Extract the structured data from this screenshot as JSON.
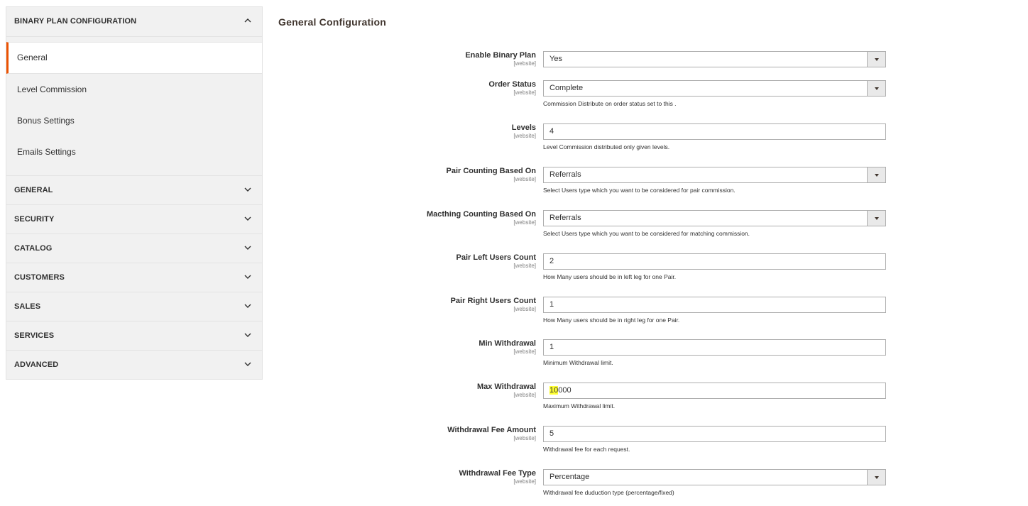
{
  "sidebar": {
    "open_section": {
      "title": "BINARY PLAN CONFIGURATION",
      "items": [
        {
          "label": "General",
          "active": true
        },
        {
          "label": "Level Commission",
          "active": false
        },
        {
          "label": "Bonus Settings",
          "active": false
        },
        {
          "label": "Emails Settings",
          "active": false
        }
      ]
    },
    "sections": [
      {
        "title": "GENERAL"
      },
      {
        "title": "SECURITY"
      },
      {
        "title": "CATALOG"
      },
      {
        "title": "CUSTOMERS"
      },
      {
        "title": "SALES"
      },
      {
        "title": "SERVICES"
      },
      {
        "title": "ADVANCED"
      }
    ]
  },
  "main": {
    "title": "General Configuration",
    "fields": [
      {
        "label": "Enable Binary Plan",
        "scope": "[website]",
        "type": "select",
        "value": "Yes",
        "note": ""
      },
      {
        "label": "Order Status",
        "scope": "[website]",
        "type": "select",
        "value": "Complete",
        "note": "Commission Distribute on order status set to this ."
      },
      {
        "label": "Levels",
        "scope": "[website]",
        "type": "input",
        "value": "4",
        "note": "Level Commission distributed only given levels."
      },
      {
        "label": "Pair Counting Based On",
        "scope": "[website]",
        "type": "select",
        "value": "Referrals",
        "note": "Select Users type which you want to be considered for pair commission."
      },
      {
        "label": "Macthing Counting Based On",
        "scope": "[website]",
        "type": "select",
        "value": "Referrals",
        "note": "Select Users type which you want to be considered for matching commission."
      },
      {
        "label": "Pair Left Users Count",
        "scope": "[website]",
        "type": "input",
        "value": "2",
        "note": "How Many users should be in left leg for one Pair."
      },
      {
        "label": "Pair Right Users Count",
        "scope": "[website]",
        "type": "input",
        "value": "1",
        "note": "How Many users should be in right leg for one Pair."
      },
      {
        "label": "Min Withdrawal",
        "scope": "[website]",
        "type": "input",
        "value": "1",
        "note": "Minimum Withdrawal limit."
      },
      {
        "label": "Max Withdrawal",
        "scope": "[website]",
        "type": "input",
        "value": "10000",
        "value_highlight": "10",
        "value_rest": "000",
        "note": "Maximum Withdrawal limit."
      },
      {
        "label": "Withdrawal Fee Amount",
        "scope": "[website]",
        "type": "input",
        "value": "5",
        "note": "Withdrawal fee for each request."
      },
      {
        "label": "Withdrawal Fee Type",
        "scope": "[website]",
        "type": "select",
        "value": "Percentage",
        "note": "Withdrawal fee duduction type (percentage/fixed)"
      }
    ]
  },
  "colors": {
    "accent": "#eb5202",
    "highlight": "#ffff33"
  },
  "icons": {
    "expanded": "chevron-up-icon",
    "collapsed": "chevron-down-icon",
    "select": "caret-down-icon"
  }
}
